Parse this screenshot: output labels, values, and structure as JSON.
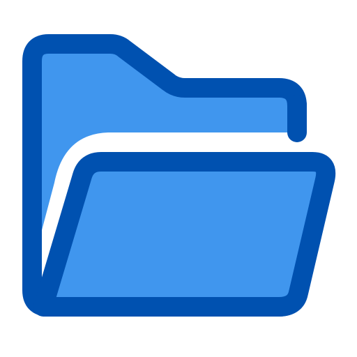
{
  "icon": {
    "name": "folder-open-icon",
    "colors": {
      "fill": "#4096ee",
      "stroke": "#0051b0",
      "gap": "#ffffff",
      "background": "#ffffff"
    }
  }
}
